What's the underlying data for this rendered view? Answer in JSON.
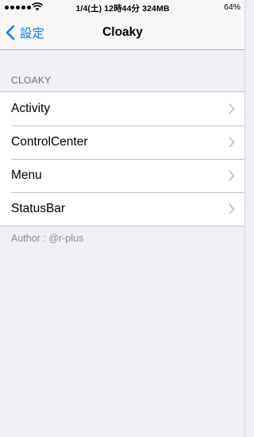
{
  "status_bar": {
    "datetime_memory": "1/4(土) 12時44分 324MB",
    "battery": "64%",
    "signal_icon": "signal-dots-icon",
    "wifi_icon": "wifi-icon"
  },
  "navbar": {
    "back_label": "設定",
    "title": "Cloaky",
    "back_icon": "chevron-left-icon"
  },
  "section": {
    "header": "CLOAKY",
    "items": [
      {
        "label": "Activity"
      },
      {
        "label": "ControlCenter"
      },
      {
        "label": "Menu"
      },
      {
        "label": "StatusBar"
      }
    ],
    "footer": "Author : @r-plus"
  },
  "colors": {
    "accent": "#0a7aff",
    "background": "#efeff4",
    "separator": "#c8c7cc",
    "chevron": "#c7c7cc"
  }
}
